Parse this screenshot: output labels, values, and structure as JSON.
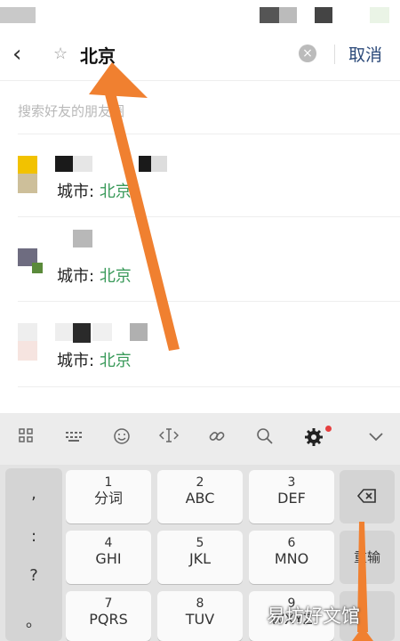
{
  "search": {
    "back_icon": "chevron-left-icon",
    "star_icon": "star-outline-icon",
    "query": "北京",
    "clear_icon": "clear-circle-icon",
    "cancel_label": "取消",
    "hint": "搜索好友的朋友圈"
  },
  "results": [
    {
      "city_label": "城市:",
      "city_value": "北京"
    },
    {
      "city_label": "城市:",
      "city_value": "北京"
    },
    {
      "city_label": "城市:",
      "city_value": "北京"
    }
  ],
  "keyboard": {
    "toolbar_icons": [
      "grid-icon",
      "keyboard-icon",
      "emoji-icon",
      "cursor-icon",
      "link-icon",
      "search-icon",
      "settings-icon",
      "chevron-down-icon"
    ],
    "punctuation": [
      ",",
      ":",
      "?",
      "。"
    ],
    "keys": [
      {
        "num": "1",
        "letters": "分词"
      },
      {
        "num": "2",
        "letters": "ABC"
      },
      {
        "num": "3",
        "letters": "DEF"
      },
      {
        "num": "4",
        "letters": "GHI"
      },
      {
        "num": "5",
        "letters": "JKL"
      },
      {
        "num": "6",
        "letters": "MNO"
      },
      {
        "num": "7",
        "letters": "PQRS"
      },
      {
        "num": "8",
        "letters": "TUV"
      },
      {
        "num": "9",
        "letters": "WXYZ"
      }
    ],
    "backspace_icon": "backspace-icon",
    "resend_label": "重输"
  },
  "watermark": "易坊好文馆",
  "colors": {
    "accent_green": "#3a9a5a",
    "cancel_blue": "#2c4a7a",
    "arrow_orange": "#f08030"
  }
}
